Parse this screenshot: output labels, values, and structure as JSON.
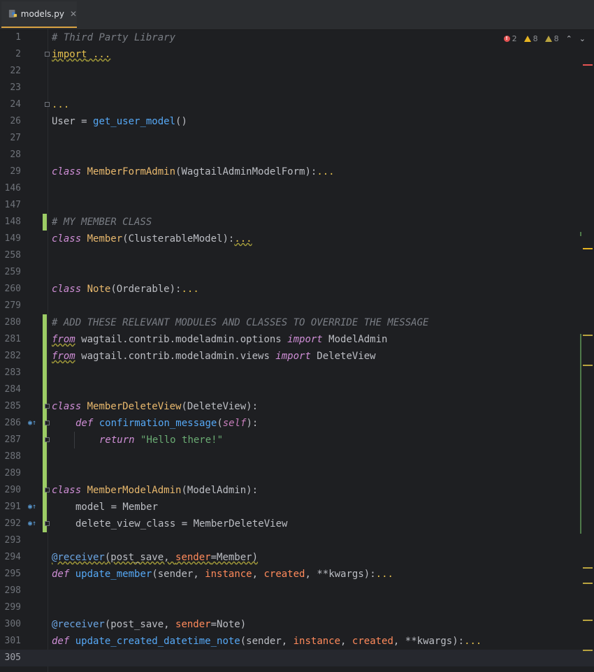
{
  "tab": {
    "label": "models.py",
    "close": "✕",
    "icon": "python-file-icon"
  },
  "inspections": {
    "errors": "2",
    "warnings": "8",
    "weak_warnings": "8",
    "prev": "⌃",
    "next": "⌄"
  },
  "lines": [
    {
      "n": "1"
    },
    {
      "n": "2"
    },
    {
      "n": "22"
    },
    {
      "n": "23"
    },
    {
      "n": "24"
    },
    {
      "n": "26"
    },
    {
      "n": "27"
    },
    {
      "n": "28"
    },
    {
      "n": "29"
    },
    {
      "n": "146"
    },
    {
      "n": "147"
    },
    {
      "n": "148"
    },
    {
      "n": "149"
    },
    {
      "n": "258"
    },
    {
      "n": "259"
    },
    {
      "n": "260"
    },
    {
      "n": "279"
    },
    {
      "n": "280"
    },
    {
      "n": "281"
    },
    {
      "n": "282"
    },
    {
      "n": "283"
    },
    {
      "n": "284"
    },
    {
      "n": "285"
    },
    {
      "n": "286"
    },
    {
      "n": "287"
    },
    {
      "n": "288"
    },
    {
      "n": "289"
    },
    {
      "n": "290"
    },
    {
      "n": "291"
    },
    {
      "n": "292"
    },
    {
      "n": "293"
    },
    {
      "n": "294"
    },
    {
      "n": "295"
    },
    {
      "n": "298"
    },
    {
      "n": "299"
    },
    {
      "n": "300"
    },
    {
      "n": "301"
    },
    {
      "n": "305"
    }
  ],
  "code": {
    "l1": "# Third Party Library",
    "l2_kw": "import",
    "l2_dots": " ...",
    "l24": "...",
    "l26_a": "User",
    "l26_b": " = ",
    "l26_fn": "get_user_model",
    "l26_c": "()",
    "l29_kw": "class",
    "l29_cls": "MemberFormAdmin",
    "l29_p": "(WagtailAdminModelForm):",
    "l29_d": "...",
    "l148": "# MY MEMBER CLASS",
    "l149_kw": "class",
    "l149_cls": "Member",
    "l149_p": "(ClusterableModel):",
    "l149_d": "...",
    "l260_kw": "class",
    "l260_cls": "Note",
    "l260_p": "(Orderable):",
    "l260_d": "...",
    "l280": "# ADD THESE RELEVANT MODULES AND CLASSES TO OVERRIDE THE MESSAGE",
    "l281_kw1": "from",
    "l281_mod": " wagtail.contrib.modeladmin.options ",
    "l281_kw2": "import",
    "l281_name": " ModelAdmin",
    "l282_kw1": "from",
    "l282_mod": " wagtail.contrib.modeladmin.views ",
    "l282_kw2": "import",
    "l282_name": " DeleteView",
    "l285_kw": "class",
    "l285_cls": "MemberDeleteView",
    "l285_p": "(DeleteView):",
    "l286_kw": "def",
    "l286_fn": "confirmation_message",
    "l286_o": "(",
    "l286_self": "self",
    "l286_c": "):",
    "l287_kw": "return",
    "l287_str": "\"Hello there!\"",
    "l290_kw": "class",
    "l290_cls": "MemberModelAdmin",
    "l290_p": "(ModelAdmin):",
    "l291": "model = Member",
    "l292": "delete_view_class = MemberDeleteView",
    "l294_dec": "@receiver",
    "l294_a": "(post_save, ",
    "l294_param": "sender",
    "l294_b": "=Member)",
    "l295_kw": "def",
    "l295_fn": "update_member",
    "l295_a": "(sender, ",
    "l295_p1": "instance",
    "l295_b": ", ",
    "l295_p2": "created",
    "l295_c": ", **kwargs):",
    "l295_d": "...",
    "l300_dec": "@receiver",
    "l300_a": "(post_save, ",
    "l300_param": "sender",
    "l300_b": "=Note)",
    "l301_kw": "def",
    "l301_fn": "update_created_datetime_note",
    "l301_a": "(sender, ",
    "l301_p1": "instance",
    "l301_b": ", ",
    "l301_p2": "created",
    "l301_c": ", **kwargs):",
    "l301_d": "..."
  },
  "colors": {
    "background": "#1e1f22",
    "keyword": "#cf8ed6",
    "class_name": "#e8b86d",
    "function": "#56a8f5",
    "string": "#6aab73",
    "comment": "#7a7e85",
    "change_marker": "#9ccc65",
    "error": "#e55353",
    "warning": "#e6b422"
  }
}
